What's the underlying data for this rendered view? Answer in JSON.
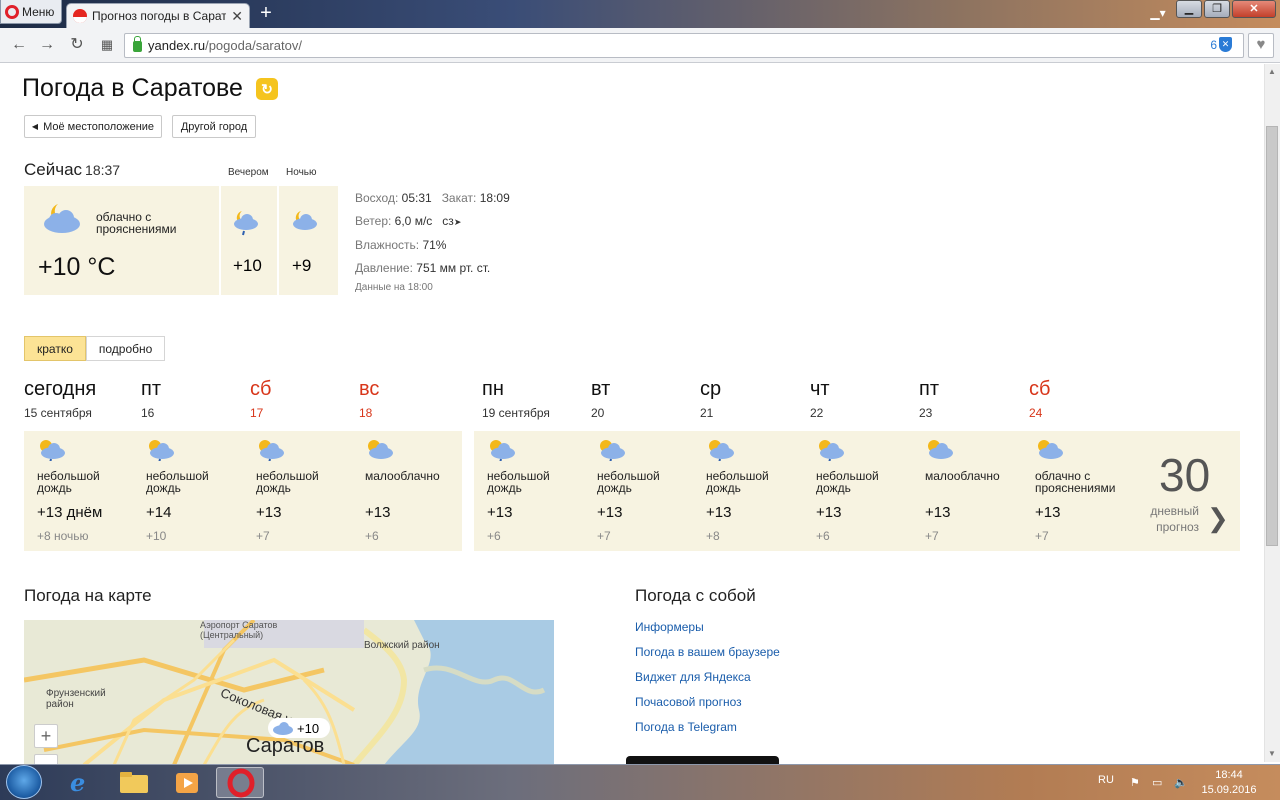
{
  "browser": {
    "menu_label": "Меню",
    "tab_title": "Прогноз погоды в Сарато",
    "url_host": "yandex.ru",
    "url_path": "/pogoda/saratov/",
    "badge_count": "6"
  },
  "page": {
    "title": "Погода в Саратове",
    "my_location": "Моё местоположение",
    "other_city": "Другой город"
  },
  "now": {
    "label": "Сейчас",
    "time": "18:37",
    "condition": "облачно с прояснениями",
    "temp": "+10 °С",
    "evening_label": "Вечером",
    "night_label": "Ночью",
    "evening_temp": "+10",
    "night_temp": "+9"
  },
  "details": {
    "sunrise_label": "Восход:",
    "sunrise": "05:31",
    "sunset_label": "Закат:",
    "sunset": "18:09",
    "wind_label": "Ветер:",
    "wind": "6,0 м/с",
    "wind_dir": "сз",
    "humidity_label": "Влажность:",
    "humidity": "71%",
    "pressure_label": "Давление:",
    "pressure": "751 мм рт. ст.",
    "data_time": "Данные на 18:00"
  },
  "forecast_tabs": [
    "кратко",
    "подробно"
  ],
  "days": [
    {
      "name": "сегодня",
      "date": "15 сентября",
      "weekend": false,
      "desc": "небольшой дождь",
      "day": "+13 днём",
      "night": "+8 ночью",
      "icon": "sun-cloud-rain-icon"
    },
    {
      "name": "пт",
      "date": "16",
      "weekend": false,
      "desc": "небольшой дождь",
      "day": "+14",
      "night": "+10",
      "icon": "sun-cloud-rain-icon"
    },
    {
      "name": "сб",
      "date": "17",
      "weekend": true,
      "desc": "небольшой дождь",
      "day": "+13",
      "night": "+7",
      "icon": "sun-cloud-rain-icon"
    },
    {
      "name": "вс",
      "date": "18",
      "weekend": true,
      "desc": "малооблачно",
      "day": "+13",
      "night": "+6",
      "icon": "sun-cloud-icon"
    },
    {
      "name": "пн",
      "date": "19 сентября",
      "weekend": false,
      "desc": "небольшой дождь",
      "day": "+13",
      "night": "+6",
      "icon": "sun-cloud-rain-icon"
    },
    {
      "name": "вт",
      "date": "20",
      "weekend": false,
      "desc": "небольшой дождь",
      "day": "+13",
      "night": "+7",
      "icon": "sun-cloud-rain-icon"
    },
    {
      "name": "ср",
      "date": "21",
      "weekend": false,
      "desc": "небольшой дождь",
      "day": "+13",
      "night": "+8",
      "icon": "sun-cloud-rain-icon"
    },
    {
      "name": "чт",
      "date": "22",
      "weekend": false,
      "desc": "небольшой дождь",
      "day": "+13",
      "night": "+6",
      "icon": "sun-cloud-rain-icon"
    },
    {
      "name": "пт",
      "date": "23",
      "weekend": false,
      "desc": "малооблачно",
      "day": "+13",
      "night": "+7",
      "icon": "sun-cloud-icon"
    },
    {
      "name": "сб",
      "date": "24",
      "weekend": true,
      "desc": "облачно с прояснениями",
      "day": "+13",
      "night": "+7",
      "icon": "sun-cloud-icon"
    }
  ],
  "thirty": {
    "number": "30",
    "label": "дневный прогноз"
  },
  "map": {
    "heading": "Погода на карте",
    "airport": "Аэропорт Саратов (Центральный)",
    "district1": "Волжский район",
    "district2": "Фрунзенский район",
    "street": "Соколовая ул.",
    "city": "Саратов",
    "temp": "+10"
  },
  "take_along": {
    "heading": "Погода с собой",
    "links": [
      "Информеры",
      "Погода в вашем браузере",
      "Виджет для Яндекса",
      "Почасовой прогноз",
      "Погода в Telegram"
    ]
  },
  "taskbar": {
    "lang": "RU",
    "time": "18:44",
    "date": "15.09.2016"
  }
}
